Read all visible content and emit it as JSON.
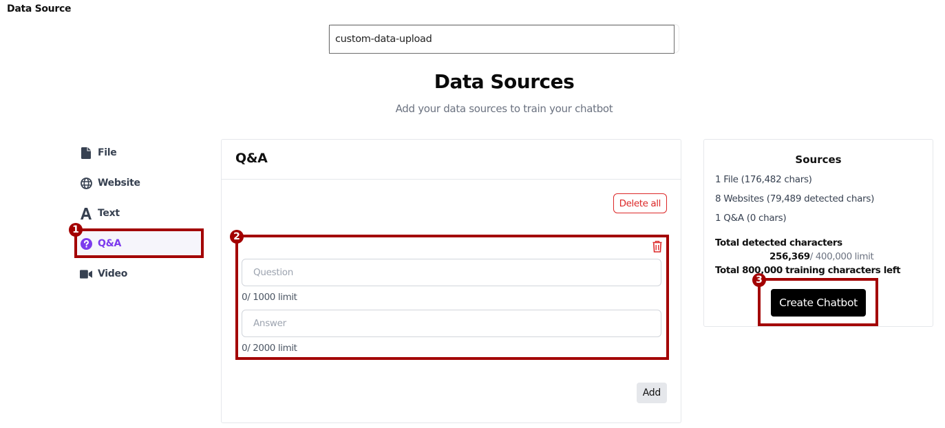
{
  "app": {
    "title": "Data Source"
  },
  "name_input": {
    "value": "custom-data-upload"
  },
  "header": {
    "title": "Data Sources",
    "subtitle": "Add your data sources to train your chatbot"
  },
  "sidebar": {
    "items": [
      {
        "label": "File",
        "icon": "file-icon"
      },
      {
        "label": "Website",
        "icon": "globe-icon"
      },
      {
        "label": "Text",
        "icon": "text-icon"
      },
      {
        "label": "Q&A",
        "icon": "question-circle-icon",
        "active": true
      },
      {
        "label": "Video",
        "icon": "video-icon"
      }
    ]
  },
  "qa_panel": {
    "title": "Q&A",
    "delete_all_label": "Delete all",
    "item": {
      "question_placeholder": "Question",
      "question_value": "",
      "question_limit": "0/ 1000 limit",
      "answer_placeholder": "Answer",
      "answer_value": "",
      "answer_limit": "0/ 2000 limit"
    },
    "add_label": "Add"
  },
  "sources_panel": {
    "title": "Sources",
    "lines": [
      "1 File (176,482 chars)",
      "8 Websites (79,489 detected chars)",
      "1 Q&A (0 chars)"
    ],
    "total_label": "Total detected characters",
    "total_value": "256,369",
    "total_limit": "/ 400,000 limit",
    "training_left": "Total 800,000 training characters left",
    "create_label": "Create Chatbot"
  },
  "annotations": [
    {
      "number": "1",
      "target": "Q&A sidebar item"
    },
    {
      "number": "2",
      "target": "Q&A entry"
    },
    {
      "number": "3",
      "target": "Create Chatbot button"
    }
  ],
  "colors": {
    "accent": "#7c3aed",
    "danger": "#dc2626",
    "annotation": "#a30000"
  }
}
